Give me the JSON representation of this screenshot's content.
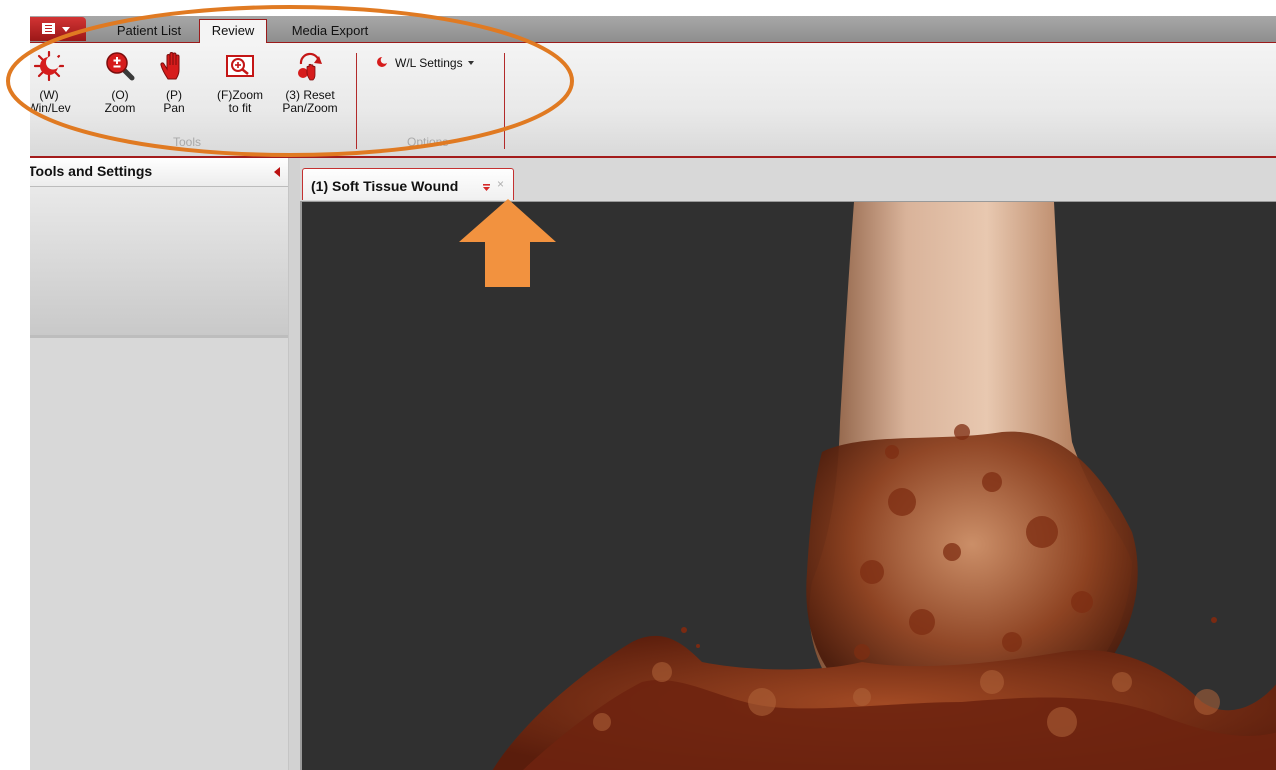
{
  "ribbon": {
    "app_menu_icon": "menu-book-icon",
    "tabs": [
      {
        "label": "Patient List",
        "active": false
      },
      {
        "label": "Review",
        "active": true
      },
      {
        "label": "Media Export",
        "active": false
      }
    ],
    "tools": [
      {
        "key": "(W)",
        "name": "Win/Lev",
        "icon": "window-level-icon"
      },
      {
        "key": "(O)",
        "name": "Zoom",
        "icon": "zoom-magnifier-icon"
      },
      {
        "key": "(P)",
        "name": "Pan",
        "icon": "pan-hand-icon"
      },
      {
        "key": "(F)Zoom",
        "name": "to fit",
        "icon": "zoom-to-fit-icon"
      },
      {
        "key": "(3) Reset",
        "name": "Pan/Zoom",
        "icon": "reset-pan-zoom-icon"
      }
    ],
    "tools_group_label": "Tools",
    "wl_settings_label": "W/L Settings",
    "options_group_label": "Options",
    "accent_color": "#a31b1b"
  },
  "left_panel": {
    "title": "Tools and Settings"
  },
  "document": {
    "tab_title": "(1) Soft Tissue Wound",
    "close_glyph": "×",
    "viewport_background": "#303030",
    "image_subject": "3D volume rendering"
  },
  "annotations": {
    "ellipse_color": "#e07a22",
    "arrow_color": "#f2923f"
  }
}
